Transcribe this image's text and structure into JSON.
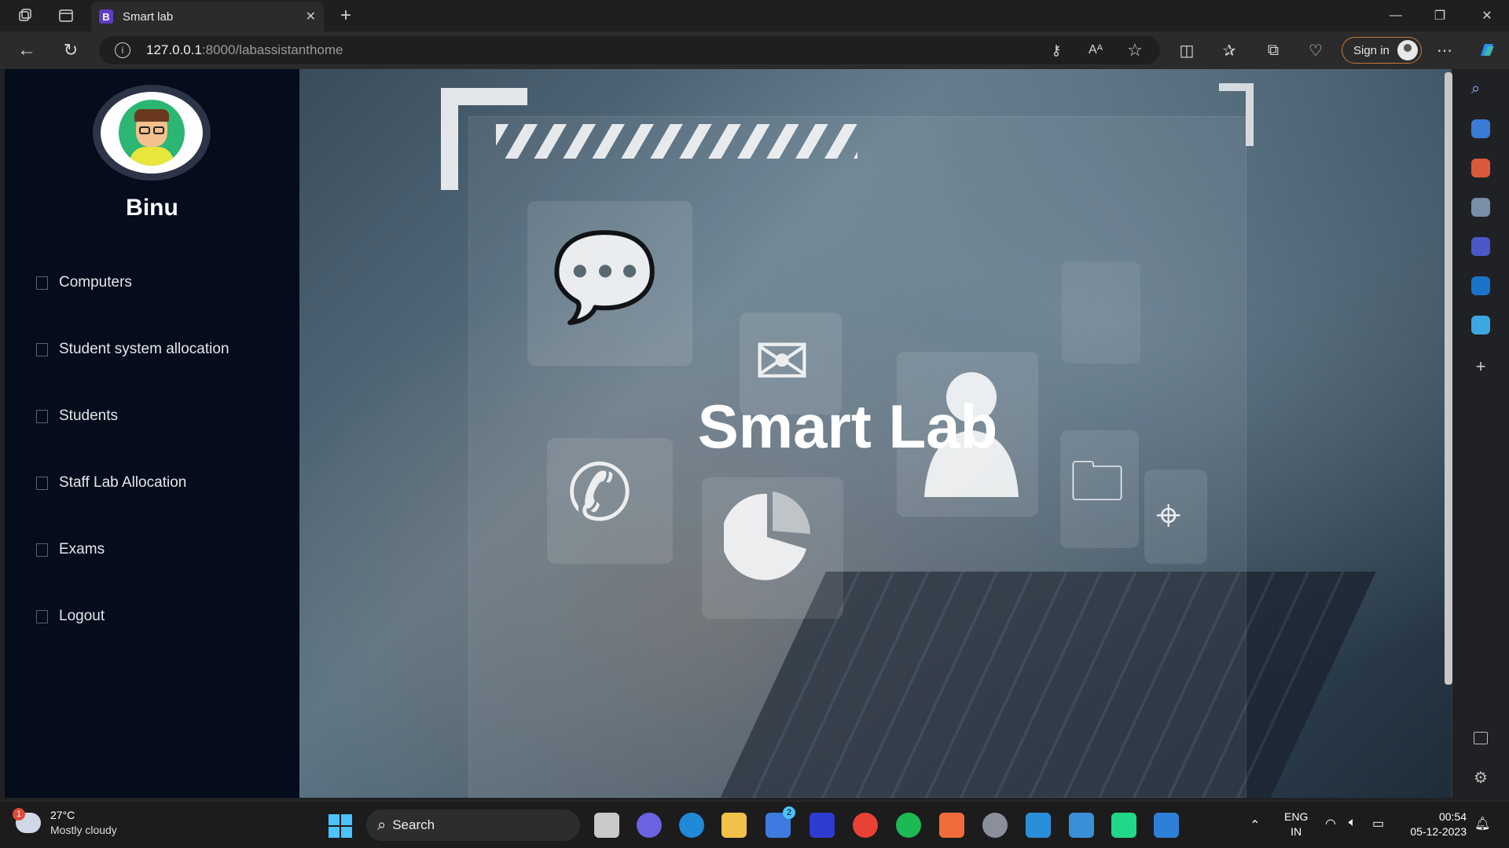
{
  "browser": {
    "tab_title": "Smart lab",
    "tab_favicon_letter": "B",
    "url_host": "127.0.0.1",
    "url_path": ":8000/labassistanthome",
    "signin_label": "Sign in"
  },
  "sidebar": {
    "user_name": "Binu",
    "items": [
      {
        "label": "Computers"
      },
      {
        "label": "Student system allocation"
      },
      {
        "label": "Students"
      },
      {
        "label": "Staff Lab Allocation"
      },
      {
        "label": "Exams"
      },
      {
        "label": "Logout"
      }
    ]
  },
  "hero": {
    "title": "Smart Lab"
  },
  "taskbar": {
    "weather_badge": "1",
    "temperature": "27°C",
    "condition": "Mostly cloudy",
    "search_label": "Search",
    "store_badge": "2",
    "lang_top": "ENG",
    "lang_bottom": "IN",
    "time": "00:54",
    "date": "05-12-2023"
  },
  "colors": {
    "sidebar_bg": "#050c1b",
    "accent_signin": "#c47a3a",
    "start_blue": "#4cc2ff"
  }
}
